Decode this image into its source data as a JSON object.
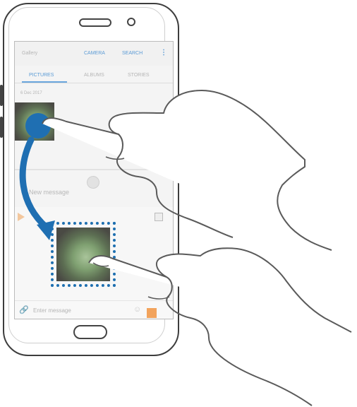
{
  "gallery": {
    "title": "Gallery",
    "actions": [
      "CAMERA",
      "SEARCH"
    ],
    "tabs": [
      "PICTURES",
      "ALBUMS",
      "STORIES"
    ],
    "date": "6 Dec 2017"
  },
  "messages": {
    "title": "New message",
    "input_placeholder": "Enter message"
  },
  "colors": {
    "accent": "#1f6fb2",
    "tab_accent": "#6aa6dd",
    "frame": "#3d3d3d"
  },
  "icons": [
    "more-vert-icon",
    "attach-icon",
    "emoji-icon",
    "contact-icon",
    "multiwindow-icon",
    "drag-arrow-icon",
    "hand-icon"
  ]
}
